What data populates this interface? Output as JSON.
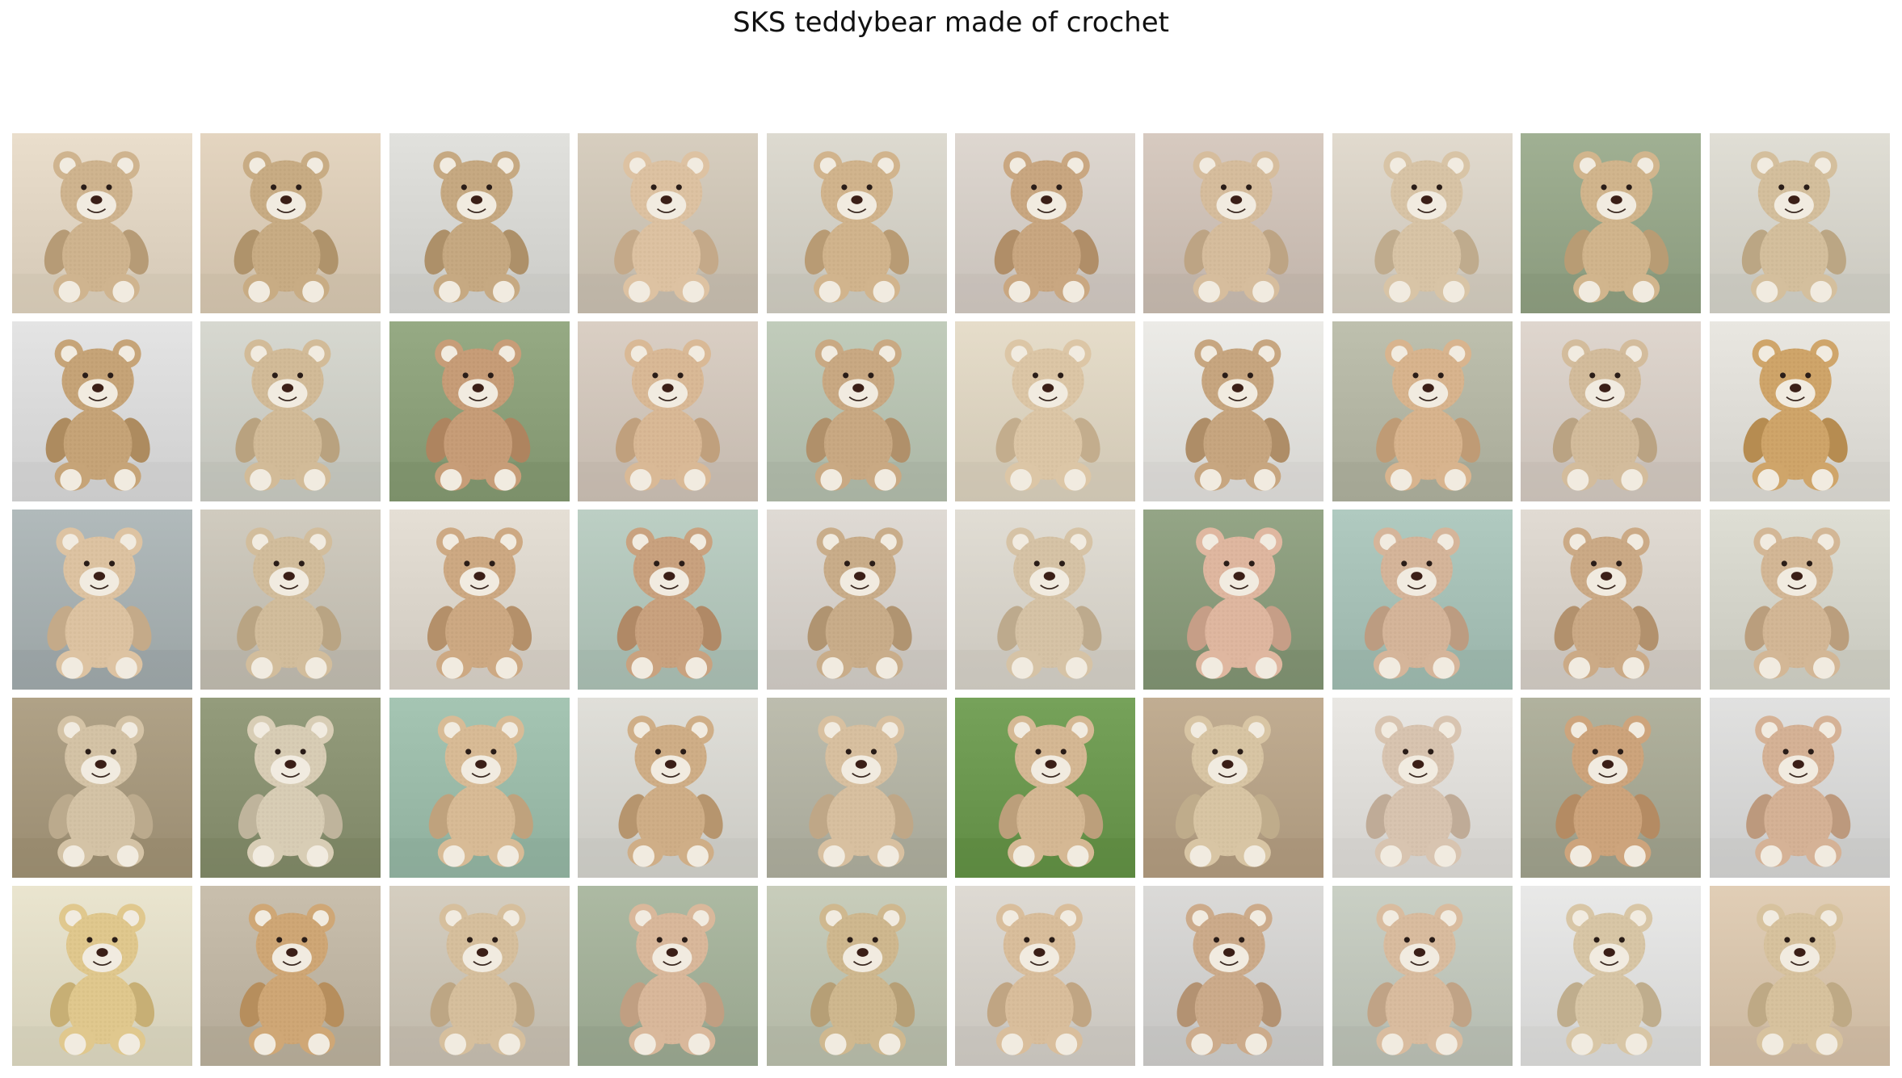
{
  "figure": {
    "title": "SKS teddybear made of crochet"
  },
  "grid": {
    "rows": 5,
    "cols": 10,
    "images": [
      {
        "bg": "#e2d6c4",
        "bear": "#cfb48f"
      },
      {
        "bg": "#dccdb8",
        "bear": "#c8ac84"
      },
      {
        "bg": "#d9d9d5",
        "bear": "#c6a982"
      },
      {
        "bg": "#cfc6b7",
        "bear": "#ddc2a2"
      },
      {
        "bg": "#d5d2c8",
        "bear": "#d1b48d"
      },
      {
        "bg": "#d6cfc8",
        "bear": "#c9a781"
      },
      {
        "bg": "#cfc2b8",
        "bear": "#d6bd9d"
      },
      {
        "bg": "#d9d2c6",
        "bear": "#d8c4a6"
      },
      {
        "bg": "#98a88b",
        "bear": "#d1b58d"
      },
      {
        "bg": "#d8d6cd",
        "bear": "#d4bf9d"
      },
      {
        "bg": "#dcdcdc",
        "bear": "#c6a478"
      },
      {
        "bg": "#cfd0c8",
        "bear": "#d2bb98"
      },
      {
        "bg": "#8ea27c",
        "bear": "#c79d78"
      },
      {
        "bg": "#d2c7bc",
        "bear": "#d9b996"
      },
      {
        "bg": "#b9c4b3",
        "bear": "#c9a983"
      },
      {
        "bg": "#ded5c2",
        "bear": "#dcc6a6"
      },
      {
        "bg": "#e4e3df",
        "bear": "#c7a680"
      },
      {
        "bg": "#b6b8a6",
        "bear": "#d8b48e"
      },
      {
        "bg": "#d7cec6",
        "bear": "#d3bc9c"
      },
      {
        "bg": "#e1dfd9",
        "bear": "#cfa56a"
      },
      {
        "bg": "#a9b2b3",
        "bear": "#ddc3a2"
      },
      {
        "bg": "#c8c3b7",
        "bear": "#d2bd9c"
      },
      {
        "bg": "#ddd7cd",
        "bear": "#cda983"
      },
      {
        "bg": "#b4c7bc",
        "bear": "#c9a27f"
      },
      {
        "bg": "#d7d2cc",
        "bear": "#c9ad8a"
      },
      {
        "bg": "#d9d5cc",
        "bear": "#d6c3a6"
      },
      {
        "bg": "#8c9d7e",
        "bear": "#dfb7a0"
      },
      {
        "bg": "#a8c2b8",
        "bear": "#d5b59a"
      },
      {
        "bg": "#d9d3cb",
        "bear": "#cbaa86"
      },
      {
        "bg": "#d6d6cc",
        "bear": "#d3b796"
      },
      {
        "bg": "#a89a7f",
        "bear": "#d4c3a6"
      },
      {
        "bg": "#8c9474",
        "bear": "#d8cdb5"
      },
      {
        "bg": "#9dbdab",
        "bear": "#d8bb96"
      },
      {
        "bg": "#d8d7d1",
        "bear": "#cfae87"
      },
      {
        "bg": "#b5b5a6",
        "bear": "#d8c0a0"
      },
      {
        "bg": "#6e9a52",
        "bear": "#d5b894"
      },
      {
        "bg": "#b9a58a",
        "bear": "#d8c5a4"
      },
      {
        "bg": "#e1dfdb",
        "bear": "#d8c4b0"
      },
      {
        "bg": "#a9aa96",
        "bear": "#cda47c"
      },
      {
        "bg": "#d9d9d8",
        "bear": "#d5b296"
      },
      {
        "bg": "#e2ddc7",
        "bear": "#e0c88e"
      },
      {
        "bg": "#c1b7a5",
        "bear": "#cfa776"
      },
      {
        "bg": "#cdc6b8",
        "bear": "#d6bf9d"
      },
      {
        "bg": "#a5b29b",
        "bear": "#d9b89b"
      },
      {
        "bg": "#c0c5b3",
        "bear": "#cfb88f"
      },
      {
        "bg": "#d6d2cb",
        "bear": "#d9be9c"
      },
      {
        "bg": "#d3d2d0",
        "bear": "#ccab8b"
      },
      {
        "bg": "#c2c8bd",
        "bear": "#d9bc9f"
      },
      {
        "bg": "#e1e1e0",
        "bear": "#d8c6a6"
      },
      {
        "bg": "#d9c6ae",
        "bear": "#d7c29e"
      }
    ]
  }
}
